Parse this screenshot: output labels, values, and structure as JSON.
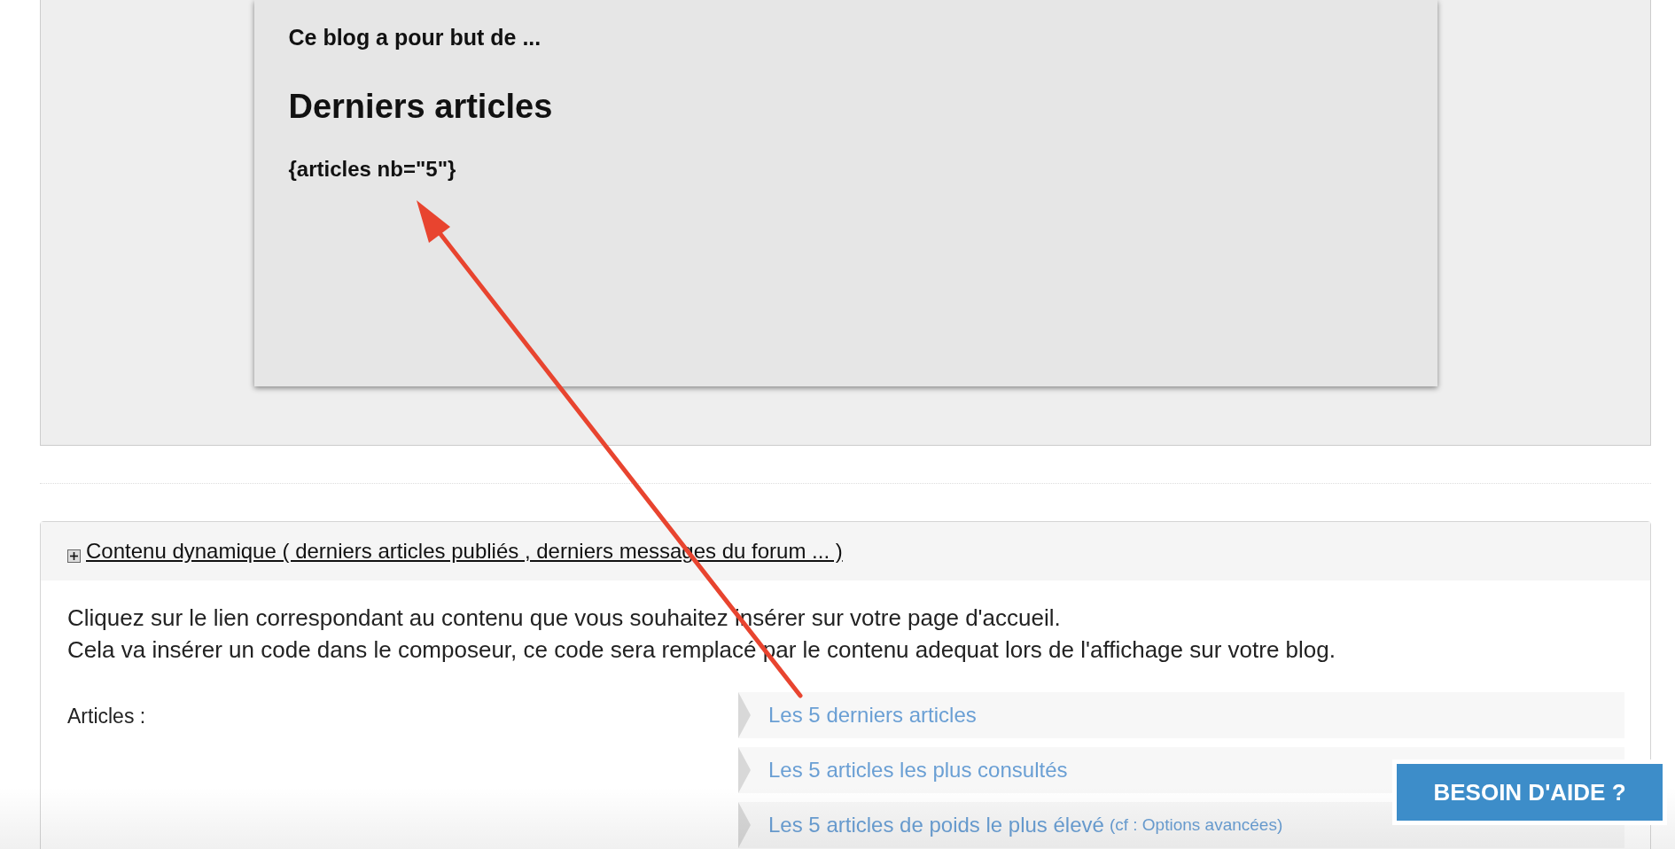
{
  "preview": {
    "intro": "Ce blog a pour but de ...",
    "heading": "Derniers articles",
    "code": "{articles nb=\"5\"}"
  },
  "section": {
    "title": "Contenu dynamique ( derniers articles publiés , derniers messages du forum ... )",
    "expanded": false,
    "paragraph": [
      "Cliquez sur le lien correspondant au contenu que vous souhaitez insérer sur votre page d'accueil.",
      "Cela va insérer un code dans le composeur, ce code sera remplacé par le contenu adequat lors de l'affichage sur votre blog."
    ],
    "group_label": "Articles :",
    "links": [
      {
        "text": "Les 5 derniers articles"
      },
      {
        "text": "Les 5 articles les plus consultés"
      },
      {
        "text": "Les 5 articles de poids le plus élevé",
        "note": "(cf : Options avancées)"
      }
    ]
  },
  "help_button": "BESOIN D'AIDE ?"
}
